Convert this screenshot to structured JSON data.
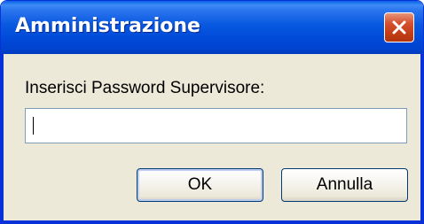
{
  "window": {
    "title": "Amministrazione"
  },
  "icons": {
    "close": "close-icon"
  },
  "dialog": {
    "prompt": "Inserisci Password Supervisore:",
    "password_value": "",
    "ok_label": "OK",
    "cancel_label": "Annulla"
  },
  "colors": {
    "titlebar": "#0858e0",
    "close_button": "#c33e16",
    "dialog_background": "#ece9d8",
    "input_border": "#7f9db9",
    "button_border": "#003c74"
  }
}
